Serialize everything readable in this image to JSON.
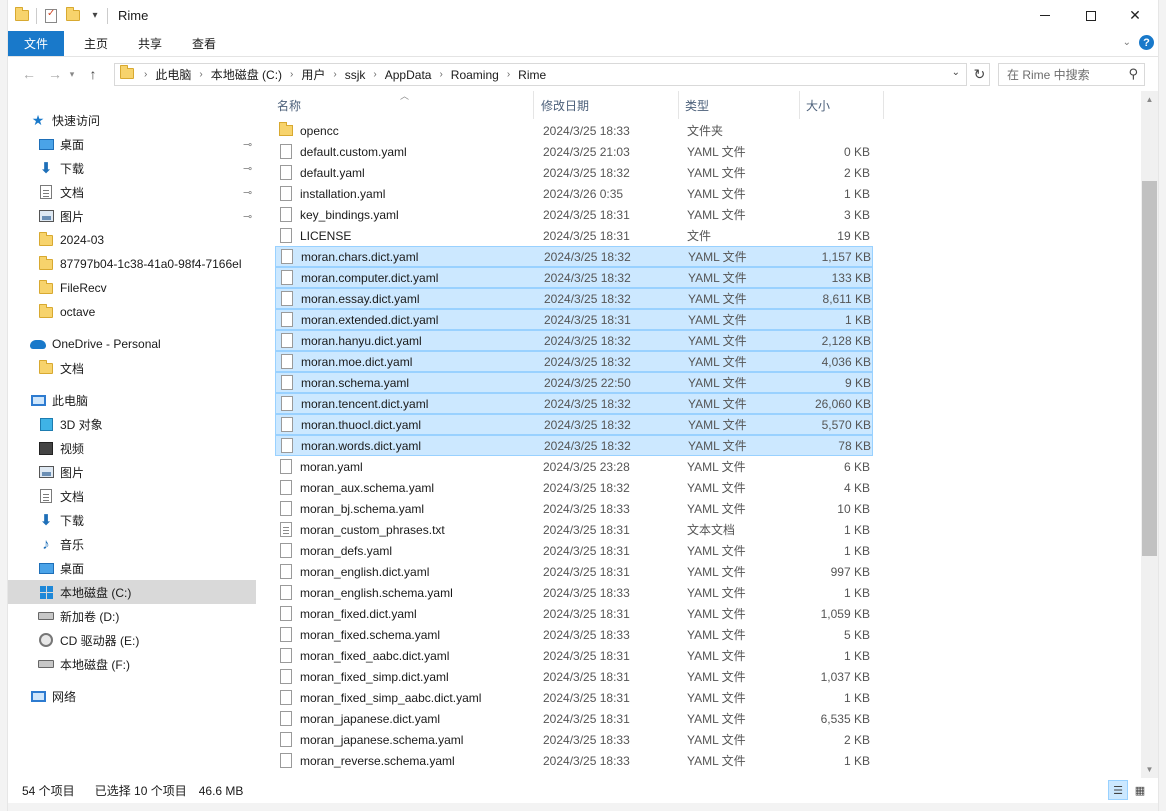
{
  "window": {
    "title": "Rime",
    "qa_dropdown": "▾",
    "min_label": "",
    "close_glyph": "✕"
  },
  "ribbon": {
    "tabs": [
      "文件",
      "主页",
      "共享",
      "查看"
    ],
    "help": "?",
    "expand": "⌄"
  },
  "nav": {
    "back": "←",
    "forward": "→",
    "recent": "▾",
    "up": "↑",
    "breadcrumbs": [
      "此电脑",
      "本地磁盘 (C:)",
      "用户",
      "ssjk",
      "AppData",
      "Roaming",
      "Rime"
    ],
    "crumb_sep": "›",
    "address_dropdown": "⌄",
    "refresh": "↻",
    "search_placeholder": "在 Rime 中搜索",
    "search_glyph": "⚲"
  },
  "sidebar": {
    "quick_access": "快速访问",
    "items": [
      {
        "label": "快速访问",
        "icon": "star-icon",
        "level": 0
      },
      {
        "label": "桌面",
        "icon": "desktop-icon",
        "level": 1,
        "pinned": true
      },
      {
        "label": "下载",
        "icon": "download-icon",
        "level": 1,
        "pinned": true
      },
      {
        "label": "文档",
        "icon": "document-icon",
        "level": 1,
        "pinned": true
      },
      {
        "label": "图片",
        "icon": "pictures-icon",
        "level": 1,
        "pinned": true
      },
      {
        "label": "2024-03",
        "icon": "folder-icon",
        "level": 1
      },
      {
        "label": "87797b04-1c38-41a0-98f4-7166el",
        "icon": "folder-icon",
        "level": 1
      },
      {
        "label": "FileRecv",
        "icon": "folder-icon",
        "level": 1
      },
      {
        "label": "octave",
        "icon": "folder-icon",
        "level": 1
      },
      {
        "label": "OneDrive - Personal",
        "icon": "onedrive-icon",
        "level": 0
      },
      {
        "label": "文档",
        "icon": "folder-icon",
        "level": 1
      },
      {
        "label": "此电脑",
        "icon": "this-pc-icon",
        "level": 0
      },
      {
        "label": "3D 对象",
        "icon": "3d-objects-icon",
        "level": 1
      },
      {
        "label": "视频",
        "icon": "video-icon",
        "level": 1
      },
      {
        "label": "图片",
        "icon": "pictures-icon",
        "level": 1
      },
      {
        "label": "文档",
        "icon": "document-icon",
        "level": 1
      },
      {
        "label": "下载",
        "icon": "download-icon",
        "level": 1
      },
      {
        "label": "音乐",
        "icon": "music-icon",
        "level": 1
      },
      {
        "label": "桌面",
        "icon": "desktop-icon",
        "level": 1
      },
      {
        "label": "本地磁盘 (C:)",
        "icon": "windows-drive-icon",
        "level": 1,
        "selected": true
      },
      {
        "label": "新加卷 (D:)",
        "icon": "drive-icon",
        "level": 1
      },
      {
        "label": "CD 驱动器 (E:)",
        "icon": "cd-drive-icon",
        "level": 1
      },
      {
        "label": "本地磁盘 (F:)",
        "icon": "drive-icon",
        "level": 1
      },
      {
        "label": "网络",
        "icon": "network-icon",
        "level": 0
      }
    ],
    "pin_glyph": "📌"
  },
  "columns": {
    "name": "名称",
    "date": "修改日期",
    "type": "类型",
    "size": "大小",
    "sort_glyph": "︿"
  },
  "files": [
    {
      "name": "opencc",
      "date": "2024/3/25 18:33",
      "type": "文件夹",
      "size": "",
      "kind": "folder",
      "selected": false
    },
    {
      "name": "default.custom.yaml",
      "date": "2024/3/25 21:03",
      "type": "YAML 文件",
      "size": "0 KB",
      "kind": "file",
      "selected": false
    },
    {
      "name": "default.yaml",
      "date": "2024/3/25 18:32",
      "type": "YAML 文件",
      "size": "2 KB",
      "kind": "file",
      "selected": false
    },
    {
      "name": "installation.yaml",
      "date": "2024/3/26 0:35",
      "type": "YAML 文件",
      "size": "1 KB",
      "kind": "file",
      "selected": false
    },
    {
      "name": "key_bindings.yaml",
      "date": "2024/3/25 18:31",
      "type": "YAML 文件",
      "size": "3 KB",
      "kind": "file",
      "selected": false
    },
    {
      "name": "LICENSE",
      "date": "2024/3/25 18:31",
      "type": "文件",
      "size": "19 KB",
      "kind": "file",
      "selected": false
    },
    {
      "name": "moran.chars.dict.yaml",
      "date": "2024/3/25 18:32",
      "type": "YAML 文件",
      "size": "1,157 KB",
      "kind": "file",
      "selected": true
    },
    {
      "name": "moran.computer.dict.yaml",
      "date": "2024/3/25 18:32",
      "type": "YAML 文件",
      "size": "133 KB",
      "kind": "file",
      "selected": true
    },
    {
      "name": "moran.essay.dict.yaml",
      "date": "2024/3/25 18:32",
      "type": "YAML 文件",
      "size": "8,611 KB",
      "kind": "file",
      "selected": true
    },
    {
      "name": "moran.extended.dict.yaml",
      "date": "2024/3/25 18:31",
      "type": "YAML 文件",
      "size": "1 KB",
      "kind": "file",
      "selected": true
    },
    {
      "name": "moran.hanyu.dict.yaml",
      "date": "2024/3/25 18:32",
      "type": "YAML 文件",
      "size": "2,128 KB",
      "kind": "file",
      "selected": true
    },
    {
      "name": "moran.moe.dict.yaml",
      "date": "2024/3/25 18:32",
      "type": "YAML 文件",
      "size": "4,036 KB",
      "kind": "file",
      "selected": true
    },
    {
      "name": "moran.schema.yaml",
      "date": "2024/3/25 22:50",
      "type": "YAML 文件",
      "size": "9 KB",
      "kind": "file",
      "selected": true
    },
    {
      "name": "moran.tencent.dict.yaml",
      "date": "2024/3/25 18:32",
      "type": "YAML 文件",
      "size": "26,060 KB",
      "kind": "file",
      "selected": true
    },
    {
      "name": "moran.thuocl.dict.yaml",
      "date": "2024/3/25 18:32",
      "type": "YAML 文件",
      "size": "5,570 KB",
      "kind": "file",
      "selected": true
    },
    {
      "name": "moran.words.dict.yaml",
      "date": "2024/3/25 18:32",
      "type": "YAML 文件",
      "size": "78 KB",
      "kind": "file",
      "selected": true
    },
    {
      "name": "moran.yaml",
      "date": "2024/3/25 23:28",
      "type": "YAML 文件",
      "size": "6 KB",
      "kind": "file",
      "selected": false
    },
    {
      "name": "moran_aux.schema.yaml",
      "date": "2024/3/25 18:32",
      "type": "YAML 文件",
      "size": "4 KB",
      "kind": "file",
      "selected": false
    },
    {
      "name": "moran_bj.schema.yaml",
      "date": "2024/3/25 18:33",
      "type": "YAML 文件",
      "size": "10 KB",
      "kind": "file",
      "selected": false
    },
    {
      "name": "moran_custom_phrases.txt",
      "date": "2024/3/25 18:31",
      "type": "文本文档",
      "size": "1 KB",
      "kind": "txt",
      "selected": false
    },
    {
      "name": "moran_defs.yaml",
      "date": "2024/3/25 18:31",
      "type": "YAML 文件",
      "size": "1 KB",
      "kind": "file",
      "selected": false
    },
    {
      "name": "moran_english.dict.yaml",
      "date": "2024/3/25 18:31",
      "type": "YAML 文件",
      "size": "997 KB",
      "kind": "file",
      "selected": false
    },
    {
      "name": "moran_english.schema.yaml",
      "date": "2024/3/25 18:33",
      "type": "YAML 文件",
      "size": "1 KB",
      "kind": "file",
      "selected": false
    },
    {
      "name": "moran_fixed.dict.yaml",
      "date": "2024/3/25 18:31",
      "type": "YAML 文件",
      "size": "1,059 KB",
      "kind": "file",
      "selected": false
    },
    {
      "name": "moran_fixed.schema.yaml",
      "date": "2024/3/25 18:33",
      "type": "YAML 文件",
      "size": "5 KB",
      "kind": "file",
      "selected": false
    },
    {
      "name": "moran_fixed_aabc.dict.yaml",
      "date": "2024/3/25 18:31",
      "type": "YAML 文件",
      "size": "1 KB",
      "kind": "file",
      "selected": false
    },
    {
      "name": "moran_fixed_simp.dict.yaml",
      "date": "2024/3/25 18:31",
      "type": "YAML 文件",
      "size": "1,037 KB",
      "kind": "file",
      "selected": false
    },
    {
      "name": "moran_fixed_simp_aabc.dict.yaml",
      "date": "2024/3/25 18:31",
      "type": "YAML 文件",
      "size": "1 KB",
      "kind": "file",
      "selected": false
    },
    {
      "name": "moran_japanese.dict.yaml",
      "date": "2024/3/25 18:31",
      "type": "YAML 文件",
      "size": "6,535 KB",
      "kind": "file",
      "selected": false
    },
    {
      "name": "moran_japanese.schema.yaml",
      "date": "2024/3/25 18:33",
      "type": "YAML 文件",
      "size": "2 KB",
      "kind": "file",
      "selected": false
    },
    {
      "name": "moran_reverse.schema.yaml",
      "date": "2024/3/25 18:33",
      "type": "YAML 文件",
      "size": "1 KB",
      "kind": "file",
      "selected": false
    }
  ],
  "status": {
    "count": "54 个项目",
    "selected": "已选择 10 个项目",
    "size": "46.6 MB"
  },
  "colors": {
    "accent": "#1979ca",
    "selection_bg": "#cce8ff",
    "selection_border": "#99d1ff",
    "header_text": "#4c607a"
  }
}
